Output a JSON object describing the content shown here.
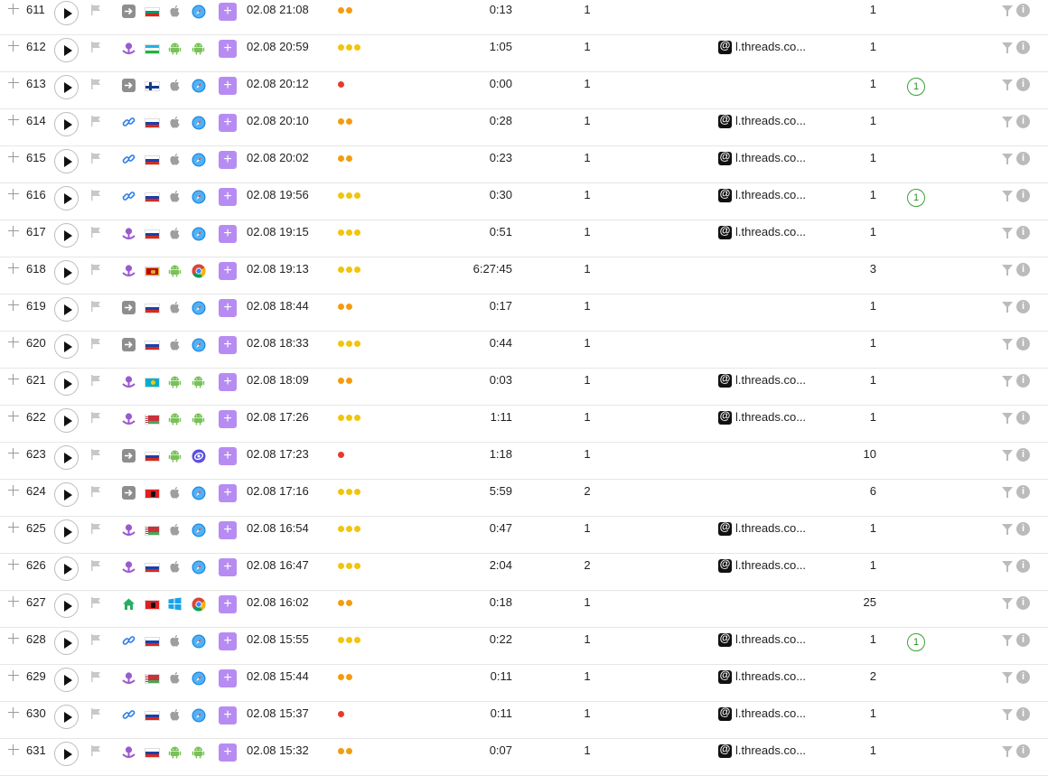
{
  "colors": {
    "dot_orange": "#f39c12",
    "dot_yellow": "#f1c40f",
    "dot_red": "#e8392b",
    "add_button": "#b78cf2",
    "goal_green": "#3aa33a"
  },
  "icons": {
    "expand": "plus-icon",
    "play": "play-icon",
    "flag": "flag-icon",
    "source_direct": "direct-entry-icon",
    "source_ad": "ad-icon",
    "source_link": "link-icon",
    "source_internal": "home-icon",
    "os_apple": "apple-icon",
    "os_android": "android-icon",
    "os_windows": "windows-icon",
    "browser_safari": "safari-icon",
    "browser_chrome": "chrome-icon",
    "browser_samsung": "samsung-browser-icon",
    "referrer": "threads-icon",
    "filter": "filter-icon",
    "info": "info-icon"
  },
  "rows": [
    {
      "num": "611",
      "source": "direct",
      "country": "bg",
      "os": "apple",
      "browser": "safari",
      "datetime": "02.08 21:08",
      "dots": [
        "o",
        "o"
      ],
      "duration": "0:13",
      "visits": "1",
      "referrer": "",
      "pages": "1",
      "goal": ""
    },
    {
      "num": "612",
      "source": "ad",
      "country": "uz",
      "os": "android",
      "browser": "android",
      "datetime": "02.08 20:59",
      "dots": [
        "y",
        "y",
        "y"
      ],
      "duration": "1:05",
      "visits": "1",
      "referrer": "l.threads.co...",
      "pages": "1",
      "goal": ""
    },
    {
      "num": "613",
      "source": "direct",
      "country": "fi",
      "os": "apple",
      "browser": "safari",
      "datetime": "02.08 20:12",
      "dots": [
        "r"
      ],
      "duration": "0:00",
      "visits": "1",
      "referrer": "",
      "pages": "1",
      "goal": "1"
    },
    {
      "num": "614",
      "source": "link",
      "country": "ru",
      "os": "apple",
      "browser": "safari",
      "datetime": "02.08 20:10",
      "dots": [
        "o",
        "o"
      ],
      "duration": "0:28",
      "visits": "1",
      "referrer": "l.threads.co...",
      "pages": "1",
      "goal": ""
    },
    {
      "num": "615",
      "source": "link",
      "country": "ru",
      "os": "apple",
      "browser": "safari",
      "datetime": "02.08 20:02",
      "dots": [
        "o",
        "o"
      ],
      "duration": "0:23",
      "visits": "1",
      "referrer": "l.threads.co...",
      "pages": "1",
      "goal": ""
    },
    {
      "num": "616",
      "source": "link",
      "country": "ru",
      "os": "apple",
      "browser": "safari",
      "datetime": "02.08 19:56",
      "dots": [
        "y",
        "y",
        "y"
      ],
      "duration": "0:30",
      "visits": "1",
      "referrer": "l.threads.co...",
      "pages": "1",
      "goal": "1"
    },
    {
      "num": "617",
      "source": "ad",
      "country": "ru",
      "os": "apple",
      "browser": "safari",
      "datetime": "02.08 19:15",
      "dots": [
        "y",
        "y",
        "y"
      ],
      "duration": "0:51",
      "visits": "1",
      "referrer": "l.threads.co...",
      "pages": "1",
      "goal": ""
    },
    {
      "num": "618",
      "source": "ad",
      "country": "me",
      "os": "android",
      "browser": "chrome",
      "datetime": "02.08 19:13",
      "dots": [
        "y",
        "y",
        "y"
      ],
      "duration": "6:27:45",
      "visits": "1",
      "referrer": "",
      "pages": "3",
      "goal": ""
    },
    {
      "num": "619",
      "source": "direct",
      "country": "ru",
      "os": "apple",
      "browser": "safari",
      "datetime": "02.08 18:44",
      "dots": [
        "o",
        "o"
      ],
      "duration": "0:17",
      "visits": "1",
      "referrer": "",
      "pages": "1",
      "goal": ""
    },
    {
      "num": "620",
      "source": "direct",
      "country": "ru",
      "os": "apple",
      "browser": "safari",
      "datetime": "02.08 18:33",
      "dots": [
        "y",
        "y",
        "y"
      ],
      "duration": "0:44",
      "visits": "1",
      "referrer": "",
      "pages": "1",
      "goal": ""
    },
    {
      "num": "621",
      "source": "ad",
      "country": "kz",
      "os": "android",
      "browser": "android",
      "datetime": "02.08 18:09",
      "dots": [
        "o",
        "o"
      ],
      "duration": "0:03",
      "visits": "1",
      "referrer": "l.threads.co...",
      "pages": "1",
      "goal": ""
    },
    {
      "num": "622",
      "source": "ad",
      "country": "by",
      "os": "android",
      "browser": "android",
      "datetime": "02.08 17:26",
      "dots": [
        "y",
        "y",
        "y"
      ],
      "duration": "1:11",
      "visits": "1",
      "referrer": "l.threads.co...",
      "pages": "1",
      "goal": ""
    },
    {
      "num": "623",
      "source": "direct",
      "country": "ru",
      "os": "android",
      "browser": "samsung",
      "datetime": "02.08 17:23",
      "dots": [
        "r"
      ],
      "duration": "1:18",
      "visits": "1",
      "referrer": "",
      "pages": "10",
      "goal": ""
    },
    {
      "num": "624",
      "source": "direct",
      "country": "al",
      "os": "apple",
      "browser": "safari",
      "datetime": "02.08 17:16",
      "dots": [
        "y",
        "y",
        "y"
      ],
      "duration": "5:59",
      "visits": "2",
      "referrer": "",
      "pages": "6",
      "goal": ""
    },
    {
      "num": "625",
      "source": "ad",
      "country": "by",
      "os": "apple",
      "browser": "safari",
      "datetime": "02.08 16:54",
      "dots": [
        "y",
        "y",
        "y"
      ],
      "duration": "0:47",
      "visits": "1",
      "referrer": "l.threads.co...",
      "pages": "1",
      "goal": ""
    },
    {
      "num": "626",
      "source": "ad",
      "country": "ru",
      "os": "apple",
      "browser": "safari",
      "datetime": "02.08 16:47",
      "dots": [
        "y",
        "y",
        "y"
      ],
      "duration": "2:04",
      "visits": "2",
      "referrer": "l.threads.co...",
      "pages": "1",
      "goal": ""
    },
    {
      "num": "627",
      "source": "internal",
      "country": "al",
      "os": "windows",
      "browser": "chrome",
      "datetime": "02.08 16:02",
      "dots": [
        "o",
        "o"
      ],
      "duration": "0:18",
      "visits": "1",
      "referrer": "",
      "pages": "25",
      "goal": ""
    },
    {
      "num": "628",
      "source": "link",
      "country": "ru",
      "os": "apple",
      "browser": "safari",
      "datetime": "02.08 15:55",
      "dots": [
        "y",
        "y",
        "y"
      ],
      "duration": "0:22",
      "visits": "1",
      "referrer": "l.threads.co...",
      "pages": "1",
      "goal": "1"
    },
    {
      "num": "629",
      "source": "ad",
      "country": "by",
      "os": "apple",
      "browser": "safari",
      "datetime": "02.08 15:44",
      "dots": [
        "o",
        "o"
      ],
      "duration": "0:11",
      "visits": "1",
      "referrer": "l.threads.co...",
      "pages": "2",
      "goal": ""
    },
    {
      "num": "630",
      "source": "link",
      "country": "ru",
      "os": "apple",
      "browser": "safari",
      "datetime": "02.08 15:37",
      "dots": [
        "r"
      ],
      "duration": "0:11",
      "visits": "1",
      "referrer": "l.threads.co...",
      "pages": "1",
      "goal": ""
    },
    {
      "num": "631",
      "source": "ad",
      "country": "ru",
      "os": "android",
      "browser": "android",
      "datetime": "02.08 15:32",
      "dots": [
        "o",
        "o"
      ],
      "duration": "0:07",
      "visits": "1",
      "referrer": "l.threads.co...",
      "pages": "1",
      "goal": ""
    }
  ]
}
